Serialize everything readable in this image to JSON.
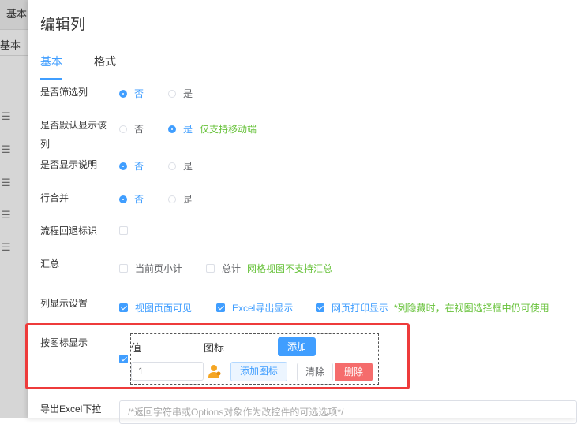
{
  "background": {
    "tab_label": "基本",
    "row_label": "基本"
  },
  "dialog": {
    "title": "编辑列",
    "tabs": [
      {
        "label": "基本"
      },
      {
        "label": "格式"
      }
    ],
    "rows": {
      "filter_col": {
        "label": "是否筛选列",
        "options": [
          "否",
          "是"
        ],
        "selected": "否"
      },
      "default_show": {
        "label_line1": "是否默认显示该",
        "label_line2": "列",
        "options": [
          "否",
          "是"
        ],
        "selected": "是",
        "note": "仅支持移动端"
      },
      "show_desc": {
        "label": "是否显示说明",
        "options": [
          "否",
          "是"
        ],
        "selected": "否"
      },
      "row_merge": {
        "label": "行合并",
        "options": [
          "否",
          "是"
        ],
        "selected": "否"
      },
      "flow_back": {
        "label": "流程回退标识",
        "checked": false
      },
      "summary": {
        "label": "汇总",
        "options": [
          {
            "label": "当前页小计",
            "checked": false
          },
          {
            "label": "总计",
            "checked": false
          }
        ],
        "note": "网格视图不支持汇总"
      },
      "display": {
        "label": "列显示设置",
        "options": [
          {
            "label": "视图页面可见",
            "checked": true
          },
          {
            "label": "Excel导出显示",
            "checked": true
          },
          {
            "label": "网页打印显示",
            "checked": true
          }
        ],
        "note": "*列隐藏时，在视图选择框中仍可使用"
      },
      "icon_display": {
        "label": "按图标显示",
        "checked": true,
        "col_value": "值",
        "col_icon": "图标",
        "add_label": "添加",
        "entries": [
          {
            "value": "1",
            "icon": "user-icon",
            "add_icon_label": "添加图标",
            "clear_label": "清除",
            "delete_label": "删除"
          }
        ]
      },
      "excel_dropdown": {
        "label": "导出Excel下拉",
        "placeholder": "/*返回字符串或Options对象作为改控件的可选选项*/"
      }
    }
  },
  "colors": {
    "accent": "#409eff",
    "green": "#67c23a",
    "danger": "#f56c6c",
    "highlight": "#ee3b3b"
  }
}
